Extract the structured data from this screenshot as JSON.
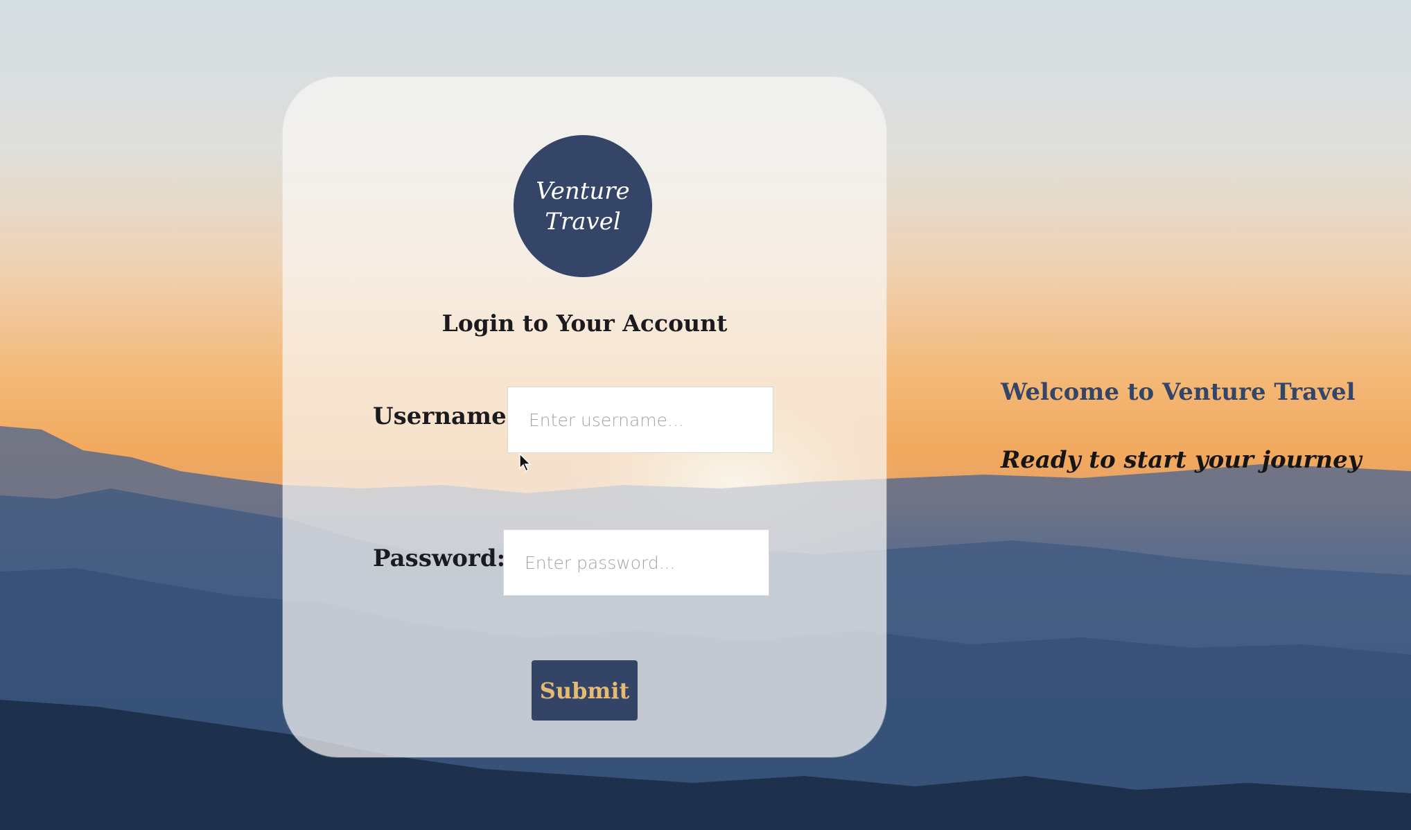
{
  "brand": {
    "logo_line1": "Venture",
    "logo_line2": "Travel"
  },
  "login": {
    "title": "Login to Your Account",
    "username_label": "Username:",
    "username_placeholder": "Enter username...",
    "username_value": "",
    "password_label": "Password:",
    "password_placeholder": "Enter password...",
    "password_value": "",
    "submit_label": "Submit"
  },
  "welcome": {
    "title": "Welcome to Venture Travel",
    "subtitle": "Ready to start your journey"
  },
  "colors": {
    "brand_navy": "#344568",
    "submit_text": "#e7ba73",
    "text_dark": "#1b1b1f"
  },
  "icons": {
    "cursor": "arrow-cursor-icon"
  }
}
